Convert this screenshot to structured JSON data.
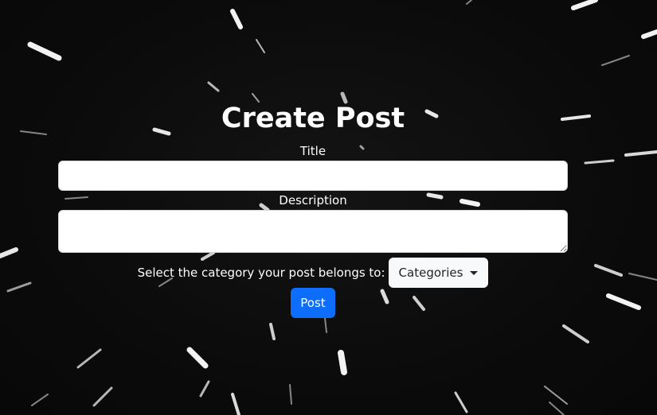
{
  "page": {
    "title": "Create Post",
    "background_color": "#0c0c0c"
  },
  "form": {
    "title_label": "Title",
    "title_value": "",
    "description_label": "Description",
    "description_value": "",
    "category_prompt": "Select the category your post belongs to:",
    "category_dropdown_label": "Categories",
    "submit_label": "Post"
  },
  "colors": {
    "primary_button": "#0d6efd",
    "light_button": "#f8f9fa",
    "text": "#ffffff"
  }
}
